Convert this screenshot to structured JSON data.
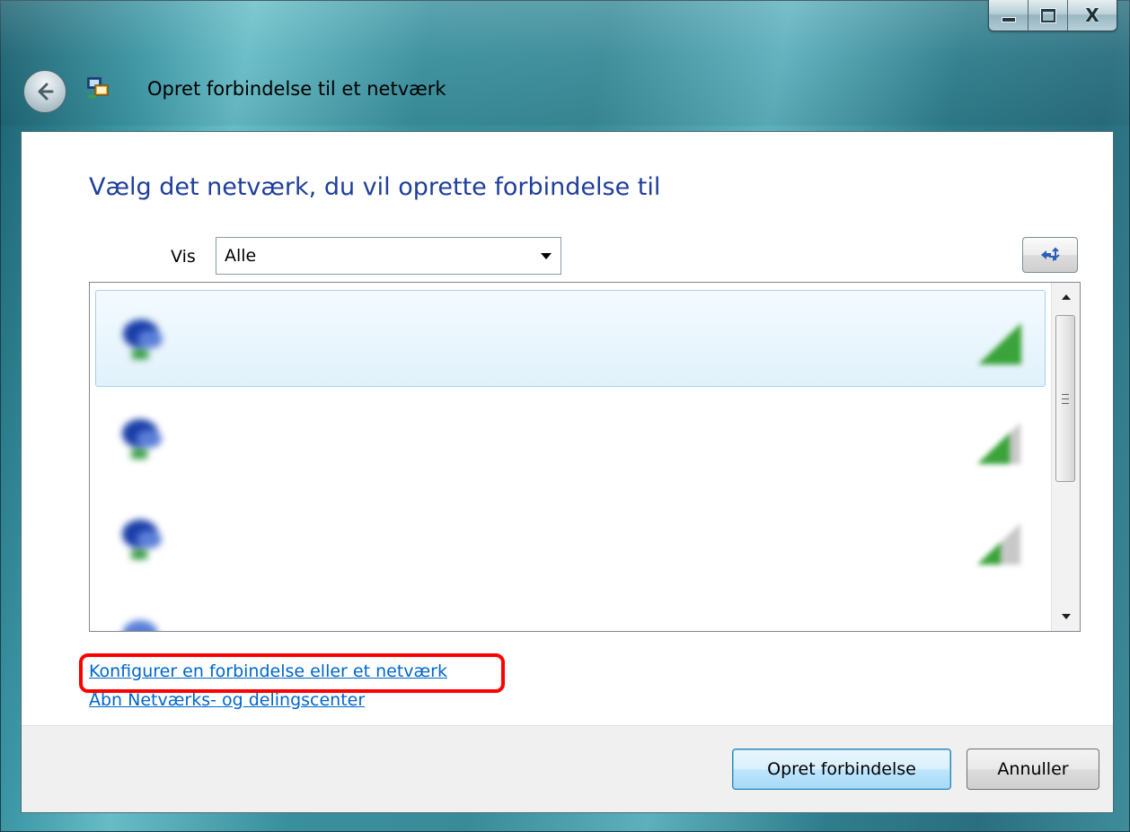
{
  "window": {
    "title": "Opret forbindelse til et netværk",
    "minimize_icon": "minimize-icon",
    "maximize_icon": "maximize-icon",
    "close_glyph": "X"
  },
  "content": {
    "heading": "Vælg det netværk, du vil oprette forbindelse til",
    "filter": {
      "label": "Vis",
      "selected": "Alle"
    },
    "refresh_icon": "refresh-icon",
    "networks": [
      {
        "name": "",
        "status": "",
        "signal_bars": 5,
        "selected": true
      },
      {
        "name": "",
        "status": "",
        "signal_bars": 4,
        "selected": false
      },
      {
        "name": "",
        "status": "",
        "signal_bars": 3,
        "selected": false
      }
    ],
    "links": {
      "configure": "Konfigurer en forbindelse eller et netværk",
      "network_center": "Åbn Netværks- og delingscenter"
    }
  },
  "footer": {
    "connect_label": "Opret forbindelse",
    "cancel_label": "Annuller"
  },
  "colors": {
    "heading": "#1e3e9b",
    "link": "#0066cc",
    "highlight": "#ff0000",
    "signal_green": "#3aa33a"
  }
}
